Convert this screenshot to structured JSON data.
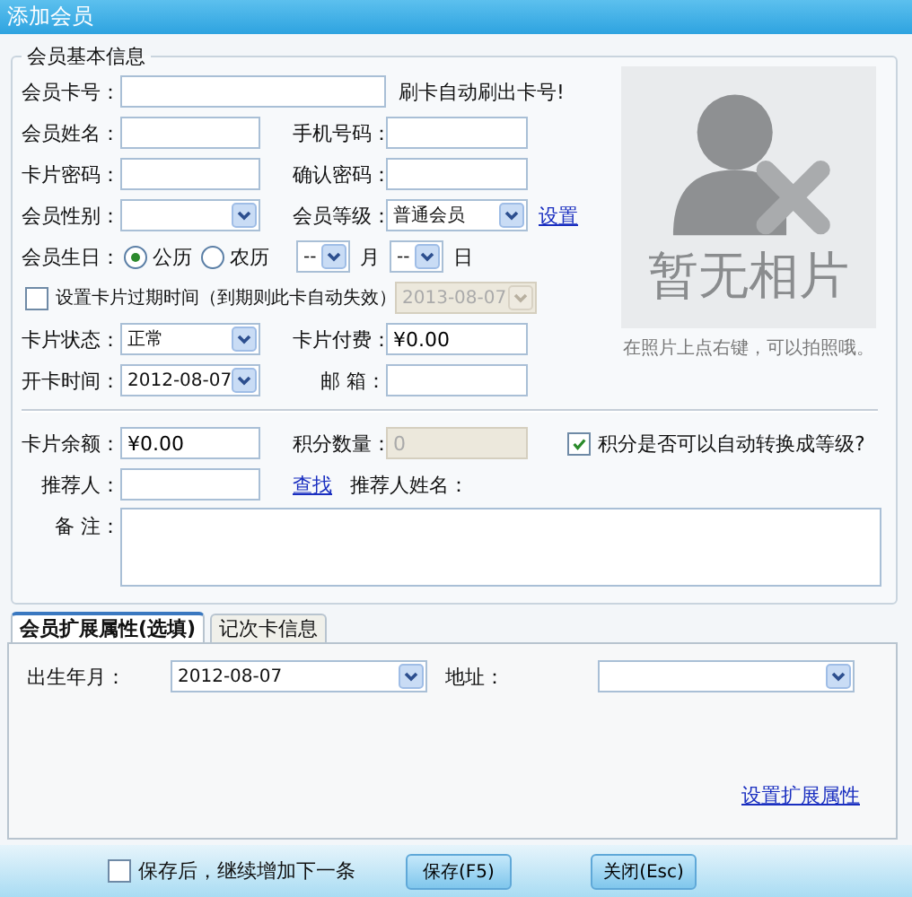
{
  "window": {
    "title": "添加会员"
  },
  "basic_info": {
    "legend": "会员基本信息",
    "card_number": {
      "label": "会员卡号："
    },
    "card_hint": "刷卡自动刷出卡号!",
    "name": {
      "label": "会员姓名："
    },
    "phone": {
      "label": "手机号码："
    },
    "password": {
      "label": "卡片密码："
    },
    "confirm_password": {
      "label": "确认密码："
    },
    "gender": {
      "label": "会员性别："
    },
    "level": {
      "label": "会员等级：",
      "value": "普通会员"
    },
    "level_link": "设置",
    "birthday": {
      "label": "会员生日：",
      "calendars": [
        {
          "label": "公历",
          "selected": true
        },
        {
          "label": "农历",
          "selected": false
        }
      ],
      "month": {
        "value": "--",
        "unit": "月"
      },
      "day": {
        "value": "--",
        "unit": "日"
      }
    },
    "expiry": {
      "label": "设置卡片过期时间（到期则此卡自动失效）",
      "checked": false,
      "value": "2013-08-07",
      "disabled": true
    },
    "card_status": {
      "label": "卡片状态：",
      "value": "正常"
    },
    "card_fee": {
      "label": "卡片付费：",
      "value": "¥0.00"
    },
    "open_date": {
      "label": "开卡时间：",
      "value": "2012-08-07"
    },
    "email": {
      "label": "邮 箱："
    },
    "balance": {
      "label": "卡片余额：",
      "value": "¥0.00"
    },
    "points": {
      "label": "积分数量：",
      "value": "0",
      "disabled": true
    },
    "auto_upgrade": {
      "label": "积分是否可以自动转换成等级?",
      "checked": true
    },
    "referrer": {
      "label": "推荐人："
    },
    "find_link": "查找",
    "referrer_name": {
      "label": "推荐人姓名："
    },
    "remarks": {
      "label": "备 注："
    },
    "photo": {
      "placeholder": "暂无相片",
      "hint": "在照片上点右键，可以拍照哦。"
    }
  },
  "tabs": [
    {
      "label": "会员扩展属性(选填)",
      "selected": true
    },
    {
      "label": "记次卡信息",
      "selected": false
    }
  ],
  "extended": {
    "birth_month": {
      "label": "出生年月：",
      "value": "2012-08-07"
    },
    "address": {
      "label": "地址："
    },
    "settings_link": "设置扩展属性"
  },
  "footer": {
    "continue": {
      "label": "保存后，继续增加下一条",
      "checked": false
    },
    "buttons": [
      {
        "label": "保存(F5)"
      },
      {
        "label": "关闭(Esc)"
      }
    ]
  }
}
